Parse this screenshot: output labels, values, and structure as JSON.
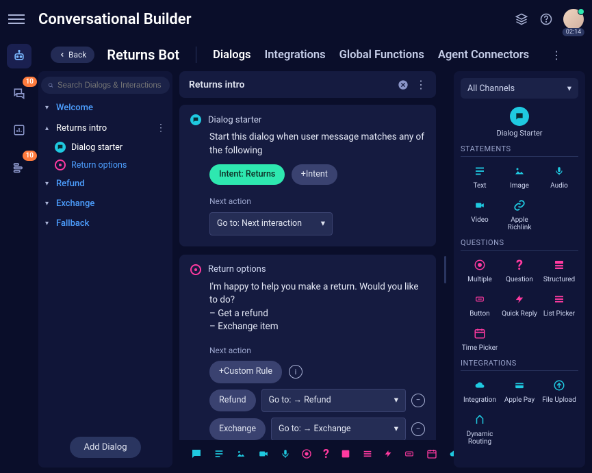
{
  "app_title": "Conversational Builder",
  "timer": "02:14",
  "rail": {
    "items": [
      {
        "name": "bot",
        "active": true
      },
      {
        "name": "conversations",
        "badge": "10"
      },
      {
        "name": "analytics"
      },
      {
        "name": "campaigns",
        "badge": "10"
      }
    ]
  },
  "back_label": "Back",
  "bot_name": "Returns Bot",
  "context_tabs": [
    "Dialogs",
    "Integrations",
    "Global Functions",
    "Agent Connectors"
  ],
  "active_tab": "Dialogs",
  "search_placeholder": "Search Dialogs & Interactions",
  "tree": {
    "items": [
      {
        "label": "Welcome",
        "expanded": false
      },
      {
        "label": "Returns intro",
        "expanded": true,
        "children": [
          {
            "label": "Dialog starter",
            "type": "starter"
          },
          {
            "label": "Return options",
            "type": "options"
          }
        ]
      },
      {
        "label": "Refund",
        "expanded": false
      },
      {
        "label": "Exchange",
        "expanded": false
      },
      {
        "label": "Fallback",
        "expanded": false
      }
    ],
    "add_dialog": "Add Dialog"
  },
  "mid_title": "Returns intro",
  "starter_card": {
    "label": "Dialog starter",
    "desc": "Start this dialog when user message matches any of the following",
    "intent_chip": "Intent: Returns",
    "add_intent": "+Intent",
    "next_action_label": "Next action",
    "next_action_value": "Go to: Next interaction"
  },
  "options_card": {
    "label": "Return options",
    "line1": "I'm happy to help you make a return. Would you like to do?",
    "line2": "– Get a refund",
    "line3": "– Exchange item",
    "next_action_label": "Next action",
    "custom_rule": "+Custom Rule",
    "rules": [
      {
        "chip": "Refund",
        "select": "Go to: → Refund"
      },
      {
        "chip": "Exchange",
        "select": "Go to: → Exchange"
      }
    ]
  },
  "palette": {
    "channels": "All Channels",
    "starter_label": "Dialog Starter",
    "sections": {
      "statements": {
        "title": "STATEMENTS",
        "items": [
          {
            "label": "Text",
            "icon": "text"
          },
          {
            "label": "Image",
            "icon": "image"
          },
          {
            "label": "Audio",
            "icon": "mic"
          },
          {
            "label": "Video",
            "icon": "video"
          },
          {
            "label": "Apple Richlink",
            "icon": "link"
          }
        ]
      },
      "questions": {
        "title": "QUESTIONS",
        "items": [
          {
            "label": "Multiple",
            "icon": "radio"
          },
          {
            "label": "Question",
            "icon": "question"
          },
          {
            "label": "Structured",
            "icon": "structured"
          },
          {
            "label": "Button",
            "icon": "button"
          },
          {
            "label": "Quick Reply",
            "icon": "bolt"
          },
          {
            "label": "List Picker",
            "icon": "list"
          },
          {
            "label": "Time Picker",
            "icon": "time"
          }
        ]
      },
      "integrations": {
        "title": "INTEGRATIONS",
        "items": [
          {
            "label": "Integration",
            "icon": "cloud"
          },
          {
            "label": "Apple Pay",
            "icon": "card"
          },
          {
            "label": "File Upload",
            "icon": "upload"
          },
          {
            "label": "Dynamic Routing",
            "icon": "route"
          }
        ]
      }
    }
  },
  "bottom_strip": [
    {
      "name": "chat",
      "color": "teal"
    },
    {
      "name": "text",
      "color": "teal"
    },
    {
      "name": "image",
      "color": "teal"
    },
    {
      "name": "video",
      "color": "teal"
    },
    {
      "name": "mic",
      "color": "teal"
    },
    {
      "name": "radio",
      "color": "pink"
    },
    {
      "name": "question",
      "color": "pink"
    },
    {
      "name": "structured",
      "color": "pink"
    },
    {
      "name": "list",
      "color": "pink"
    },
    {
      "name": "bolt",
      "color": "pink"
    },
    {
      "name": "button",
      "color": "pink"
    },
    {
      "name": "time",
      "color": "pink"
    },
    {
      "name": "cloud",
      "color": "teal"
    },
    {
      "name": "card",
      "color": "teal"
    }
  ]
}
